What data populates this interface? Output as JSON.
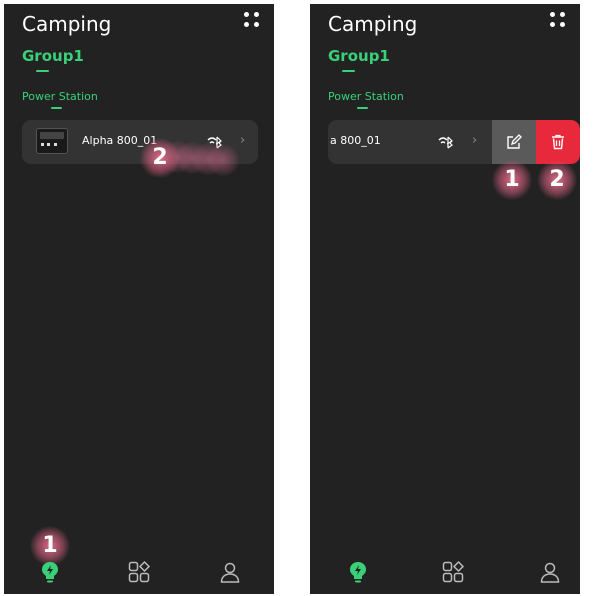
{
  "screens": [
    {
      "title": "Camping",
      "group_tab": "Group1",
      "section_label": "Power Station",
      "device": {
        "name": "Alpha 800_01"
      },
      "markers": {
        "swipe": "2",
        "nav": "1"
      }
    },
    {
      "title": "Camping",
      "group_tab": "Group1",
      "section_label": "Power Station",
      "device": {
        "name": "a 800_01"
      },
      "markers": {
        "edit": "1",
        "delete": "2"
      }
    }
  ],
  "icons": [
    "menu-dots-icon",
    "device-thumbnail",
    "bluetooth-icon",
    "chevron-right-icon",
    "edit-icon",
    "trash-icon",
    "home-bulb-icon",
    "apps-grid-icon",
    "profile-icon"
  ],
  "colors": {
    "accent": "#3ad07a",
    "background": "#222222",
    "card": "#333333",
    "delete": "#e8283b",
    "edit": "#5a5a5a"
  }
}
